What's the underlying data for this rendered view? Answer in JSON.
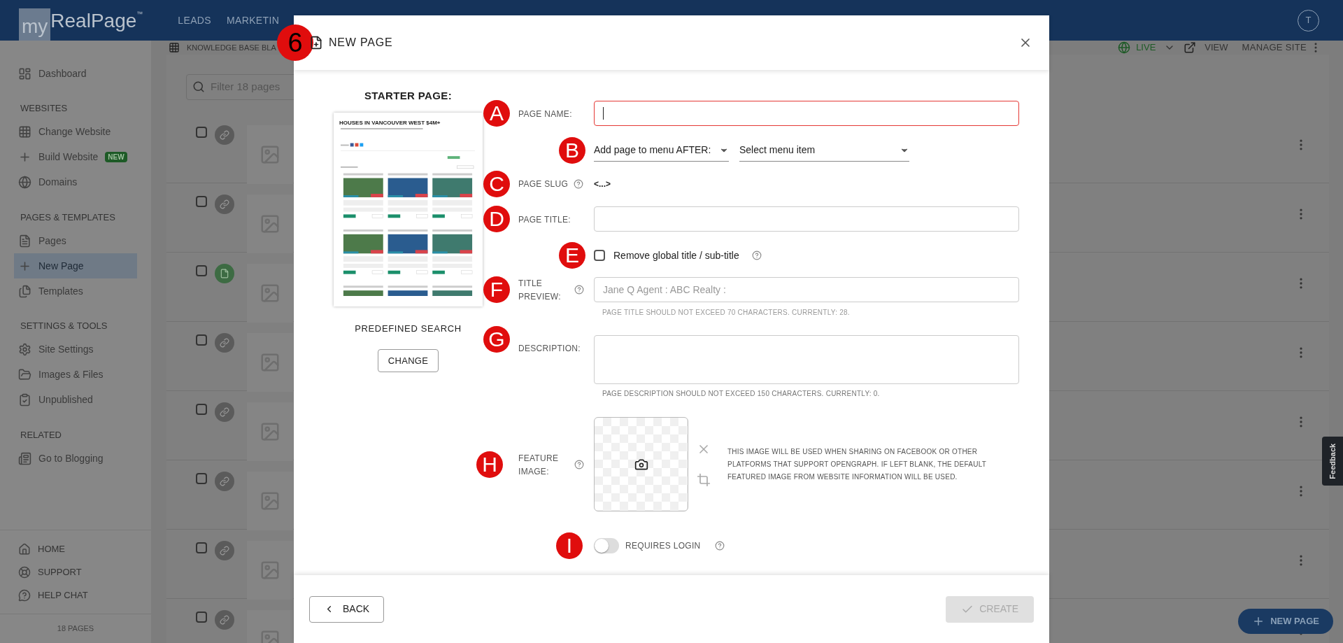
{
  "header": {
    "logo": {
      "prefix": "my",
      "brand": "RealPage",
      "tm": "™"
    },
    "nav": [
      "LEADS",
      "MARKETIN"
    ],
    "avatar": "T"
  },
  "sidebar": {
    "top": [
      {
        "label": "Dashboard",
        "selected": false
      }
    ],
    "sections": [
      {
        "title": "WEBSITES",
        "items": [
          {
            "label": "Change Website",
            "selected": false
          },
          {
            "label": "Build Website",
            "badge": "NEW",
            "selected": false
          },
          {
            "label": "Domains",
            "selected": false
          }
        ]
      },
      {
        "title": "PAGES & TEMPLATES",
        "items": [
          {
            "label": "Pages",
            "selected": false
          },
          {
            "label": "New Page",
            "selected": true
          },
          {
            "label": "Templates",
            "selected": false
          }
        ]
      },
      {
        "title": "SETTINGS & TOOLS",
        "items": [
          {
            "label": "Site Settings",
            "selected": false
          },
          {
            "label": "Images & Files",
            "selected": false
          },
          {
            "label": "Unpublished",
            "selected": false
          }
        ]
      },
      {
        "title": "RELATED",
        "items": [
          {
            "label": "Go to Blogging",
            "selected": false
          }
        ]
      }
    ],
    "bottom": [
      "HOME",
      "SUPPORT",
      "HELP CHAT"
    ],
    "count": "18 PAGES"
  },
  "toolbar": {
    "breadcrumb": "KNOWLEDGE BASE BLA",
    "status": "LIVE",
    "view": "VIEW",
    "manage": "MANAGE SITE"
  },
  "filter": {
    "placeholder": "Filter 18 pages"
  },
  "rows": [
    {
      "kind": "link",
      "checked": false
    },
    {
      "kind": "link",
      "checked": false
    },
    {
      "kind": "page",
      "checked": false
    },
    {
      "kind": "link",
      "checked": false
    },
    {
      "kind": "link",
      "checked": false
    },
    {
      "kind": "link",
      "checked": false
    },
    {
      "kind": "link",
      "checked": false
    },
    {
      "kind": "link",
      "checked": false
    }
  ],
  "feedback": "Feedback",
  "fab": "NEW PAGE",
  "modal": {
    "marker": "6",
    "title": "NEW PAGE",
    "starter": {
      "heading": "STARTER PAGE:",
      "preview_title": "HOUSES IN VANCOUVER WEST $4M+",
      "name": "PREDEFINED SEARCH",
      "button": "CHANGE"
    },
    "page_name": {
      "marker": "A",
      "label": "PAGE NAME:",
      "invalid": true
    },
    "menu": {
      "marker": "B",
      "position": "Add page to menu AFTER:",
      "item": "Select menu item"
    },
    "slug": {
      "marker": "C",
      "label": "PAGE SLUG",
      "value": "<...>"
    },
    "page_title": {
      "marker": "D",
      "label": "PAGE TITLE:"
    },
    "remove_global": {
      "marker": "E",
      "label": "Remove global title / sub-title",
      "checked": false
    },
    "title_preview": {
      "marker": "F",
      "label": "TITLE PREVIEW:",
      "value": "Jane Q Agent : ABC Realty :",
      "disabled": true,
      "hint": "PAGE TITLE SHOULD NOT EXCEED 70 CHARACTERS. CURRENTLY: 28."
    },
    "description": {
      "marker": "G",
      "label": "DESCRIPTION:",
      "hint": "PAGE DESCRIPTION SHOULD NOT EXCEED 150 CHARACTERS. CURRENTLY: 0."
    },
    "feature_image": {
      "marker": "H",
      "label": "FEATURE IMAGE:",
      "note": "THIS IMAGE WILL BE USED WHEN SHARING ON FACEBOOK OR OTHER PLATFORMS THAT SUPPORT OPENGRAPH. IF LEFT BLANK, THE DEFAULT FEATURED IMAGE FROM WEBSITE INFORMATION WILL BE USED."
    },
    "requires_login": {
      "marker": "I",
      "label": "REQUIRES LOGIN",
      "on": false
    },
    "back": "BACK",
    "create": {
      "label": "CREATE",
      "disabled": true
    }
  }
}
